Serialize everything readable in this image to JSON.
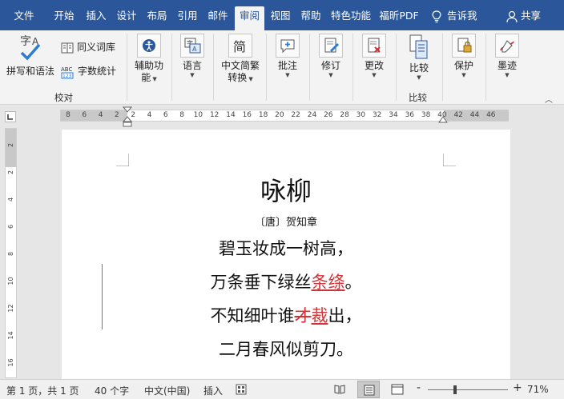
{
  "tabs": [
    {
      "label": "文件"
    },
    {
      "label": "开始"
    },
    {
      "label": "插入"
    },
    {
      "label": "设计"
    },
    {
      "label": "布局"
    },
    {
      "label": "引用"
    },
    {
      "label": "邮件"
    },
    {
      "label": "审阅"
    },
    {
      "label": "视图"
    },
    {
      "label": "帮助"
    },
    {
      "label": "特色功能"
    },
    {
      "label": "福昕PDF"
    }
  ],
  "tell_me": "告诉我",
  "share": "共享",
  "ribbon": {
    "spelling_grammar": "拼写和语法",
    "thesaurus": "同义词库",
    "word_count": "字数统计",
    "group_proofing": "校对",
    "accessibility_line1": "辅助功",
    "accessibility_line2": "能",
    "language": "语言",
    "chinese_conv_line1": "中文简繁",
    "chinese_conv_line2": "转换",
    "comments": "批注",
    "tracking": "修订",
    "changes": "更改",
    "compare": "比较",
    "group_compare": "比较",
    "protect": "保护",
    "ink": "墨迹"
  },
  "ruler": {
    "h_numbers": [
      "8",
      "6",
      "4",
      "2",
      "2",
      "4",
      "6",
      "8",
      "10",
      "12",
      "14",
      "16",
      "18",
      "20",
      "22",
      "24",
      "26",
      "28",
      "30",
      "32",
      "34",
      "36",
      "38",
      "40",
      "42",
      "44",
      "46"
    ],
    "v_numbers": [
      "2",
      "2",
      "4",
      "6",
      "8",
      "10",
      "12",
      "14",
      "16"
    ]
  },
  "document": {
    "title": "咏柳",
    "author": "〔唐〕贺知章",
    "line1": "碧玉妆成一树高，",
    "line2_pre": "万条垂下绿丝",
    "line2_ins": "条绦",
    "line2_post": "。",
    "line3_pre": "不知细叶谁",
    "line3_del": "才",
    "line3_ins": "裁",
    "line3_post": "出，",
    "line4": "二月春风似剪刀。"
  },
  "status": {
    "page": "第 1 页，共 1 页",
    "words": "40 个字",
    "language": "中文(中国)",
    "mode": "插入",
    "zoom": "71%",
    "zoom_minus": "-",
    "zoom_plus": "+",
    "zoom_level": 0.71
  },
  "colors": {
    "tab_bar": "#2b579a",
    "revision": "#d13438"
  }
}
